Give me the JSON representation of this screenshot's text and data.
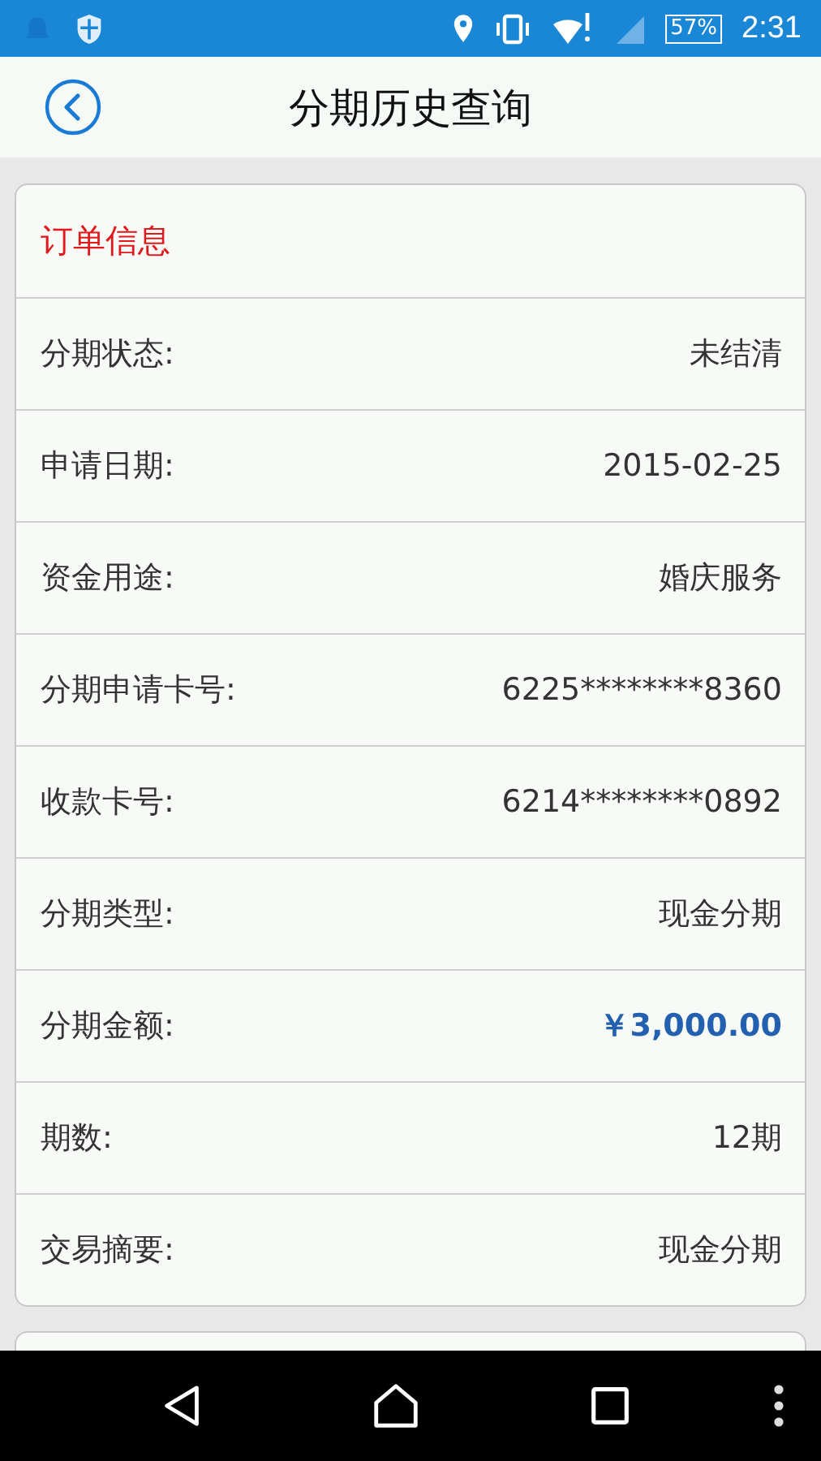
{
  "status_bar": {
    "battery": "57%",
    "time": "2:31"
  },
  "header": {
    "title": "分期历史查询"
  },
  "order_card": {
    "title": "订单信息",
    "rows": [
      {
        "label": "分期状态:",
        "value": "未结清",
        "kind": "text"
      },
      {
        "label": "申请日期:",
        "value": "2015-02-25",
        "kind": "text"
      },
      {
        "label": "资金用途:",
        "value": "婚庆服务",
        "kind": "text"
      },
      {
        "label": "分期申请卡号:",
        "value": "6225********8360",
        "kind": "text"
      },
      {
        "label": "收款卡号:",
        "value": "6214********0892",
        "kind": "text"
      },
      {
        "label": "分期类型:",
        "value": "现金分期",
        "kind": "text"
      },
      {
        "label": "分期金额:",
        "value": "￥3,000.00",
        "kind": "amount"
      },
      {
        "label": "期数:",
        "value": "12期",
        "kind": "text"
      },
      {
        "label": "交易摘要:",
        "value": "现金分期",
        "kind": "text"
      }
    ]
  }
}
